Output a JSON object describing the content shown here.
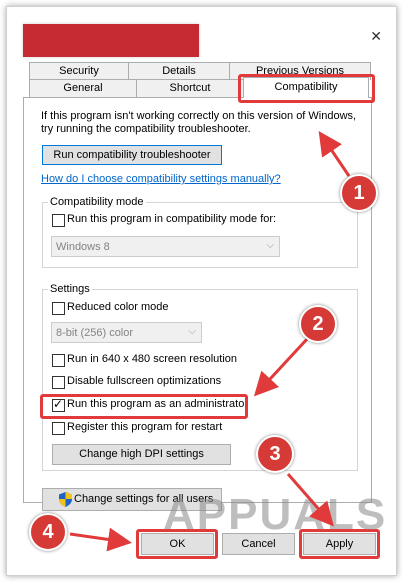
{
  "tabs": {
    "security": "Security",
    "details": "Details",
    "previous_versions": "Previous Versions",
    "general": "General",
    "shortcut": "Shortcut",
    "compatibility": "Compatibility"
  },
  "intro_line1": "If this program isn't working correctly on this version of Windows,",
  "intro_line2": "try running the compatibility troubleshooter.",
  "troubleshooter_button": "Run compatibility troubleshooter",
  "manual_link": "How do I choose compatibility settings manually?",
  "compat_mode": {
    "label": "Compatibility mode",
    "checkbox": "Run this program in compatibility mode for:",
    "checked": false,
    "os_value": "Windows 8"
  },
  "settings": {
    "label": "Settings",
    "reduced_color": {
      "label": "Reduced color mode",
      "checked": false
    },
    "color_value": "8-bit (256) color",
    "res640": {
      "label": "Run in 640 x 480 screen resolution",
      "checked": false
    },
    "disable_fullscreen": {
      "label": "Disable fullscreen optimizations",
      "checked": false
    },
    "run_admin": {
      "label": "Run this program as an administrator",
      "checked": true
    },
    "register_restart": {
      "label": "Register this program for restart",
      "checked": false
    },
    "dpi_button": "Change high DPI settings"
  },
  "all_users_button": "Change settings for all users",
  "footer": {
    "ok": "OK",
    "cancel": "Cancel",
    "apply": "Apply"
  },
  "annotations": {
    "step1": "1",
    "step2": "2",
    "step3": "3",
    "step4": "4"
  },
  "watermark": "APPUALS",
  "colors": {
    "highlight": "#e03a3a",
    "link": "#0066cc",
    "title_redaction": "#c42b33"
  }
}
